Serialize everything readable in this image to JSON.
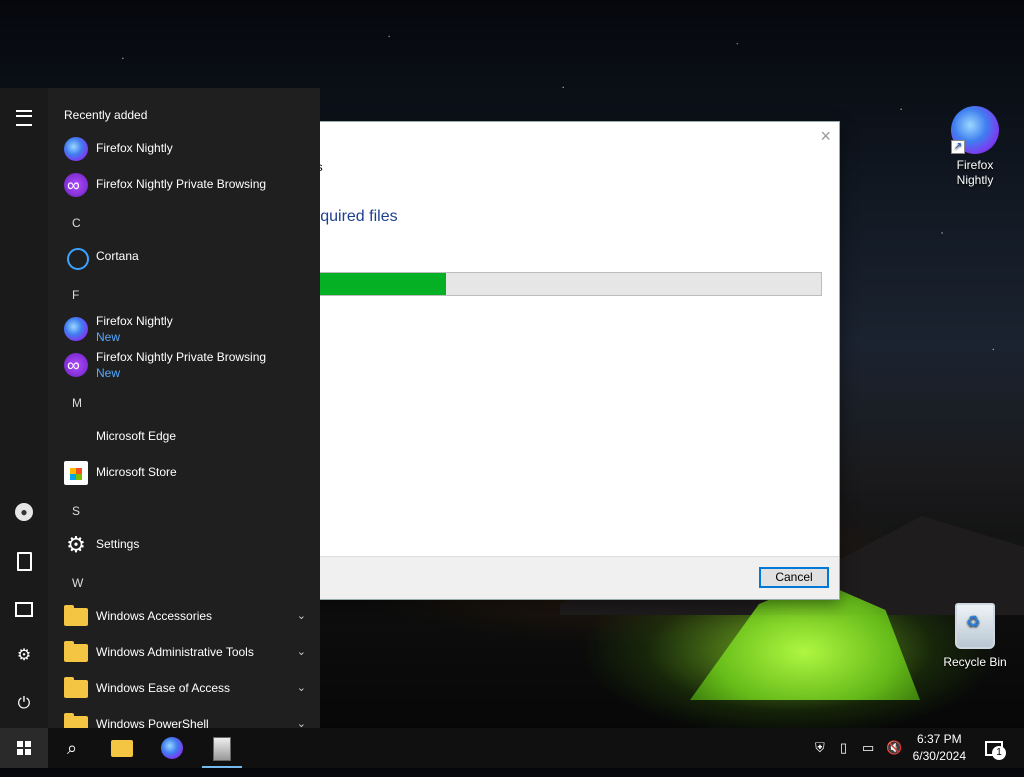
{
  "desktop": {
    "icons": [
      {
        "label": "Firefox Nightly"
      },
      {
        "label": "Recycle Bin"
      }
    ]
  },
  "installer": {
    "heading_small": "res",
    "heading_main": "required files",
    "progress_fraction": 0.27,
    "progress_color": "#06b025",
    "cancel_label": "Cancel",
    "close_glyph": "×"
  },
  "start_menu": {
    "recently_added_label": "Recently added",
    "letters": {
      "c": "C",
      "f": "F",
      "m": "M",
      "s": "S",
      "w": "W"
    },
    "apps": {
      "recent_ff": {
        "name": "Firefox Nightly",
        "icon": "firefox-nightly-icon"
      },
      "recent_ffp": {
        "name": "Firefox Nightly Private Browsing",
        "icon": "private-browsing-icon"
      },
      "cortana": {
        "name": "Cortana",
        "icon": "cortana-icon"
      },
      "ff": {
        "name": "Firefox Nightly",
        "badge": "New",
        "icon": "firefox-nightly-icon"
      },
      "ffp": {
        "name": "Firefox Nightly Private Browsing",
        "badge": "New",
        "icon": "private-browsing-icon"
      },
      "edge": {
        "name": "Microsoft Edge"
      },
      "store": {
        "name": "Microsoft Store",
        "icon": "store-icon"
      },
      "settings": {
        "name": "Settings",
        "icon": "gear-icon"
      },
      "win_acc": {
        "name": "Windows Accessories",
        "icon": "folder-icon"
      },
      "win_admin": {
        "name": "Windows Administrative Tools",
        "icon": "folder-icon"
      },
      "win_ease": {
        "name": "Windows Ease of Access",
        "icon": "folder-icon"
      },
      "win_ps": {
        "name": "Windows PowerShell",
        "icon": "folder-icon"
      }
    },
    "rail_icons": [
      "hamburger-icon",
      "user-icon",
      "documents-icon",
      "pictures-icon",
      "settings-icon",
      "power-icon"
    ]
  },
  "taskbar": {
    "time": "6:37 PM",
    "date": "6/30/2024",
    "notification_count": "1",
    "accent": "#76b9ed"
  }
}
